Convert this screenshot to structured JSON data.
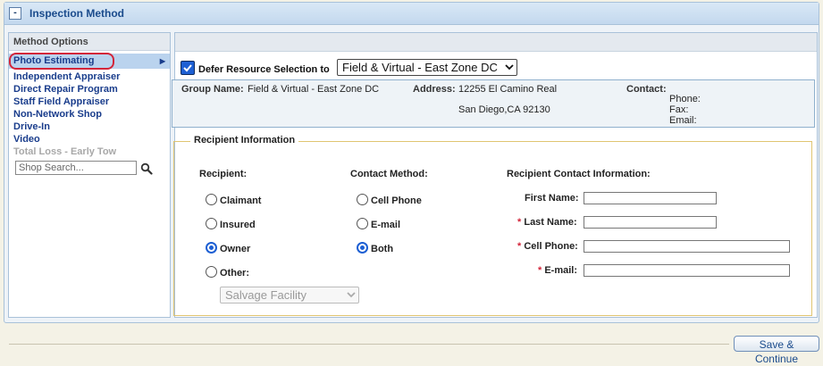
{
  "panel": {
    "title": "Inspection Method",
    "collapse_label": "-"
  },
  "method_options": {
    "heading": "Method Options",
    "selected": "Photo Estimating",
    "items": [
      "Independent Appraiser",
      "Direct Repair Program",
      "Staff Field Appraiser",
      "Non-Network Shop",
      "Drive-In",
      "Video"
    ],
    "disabled_item": "Total Loss - Early Tow",
    "shop_search_placeholder": "Shop Search..."
  },
  "defer": {
    "label": "Defer Resource Selection to",
    "checked": true,
    "selected_resource": "Field & Virtual - East Zone DC"
  },
  "group": {
    "group_name_label": "Group Name:",
    "group_name": "Field & Virtual - East Zone DC",
    "address_label": "Address:",
    "address_line1": "12255 El Camino Real",
    "address_line2": "San Diego,CA 92130",
    "contact_label": "Contact:",
    "phone_label": "Phone:",
    "fax_label": "Fax:",
    "email_label": "Email:"
  },
  "recipient": {
    "legend": "Recipient Information",
    "recipient_heading": "Recipient:",
    "recipient_options": [
      "Claimant",
      "Insured",
      "Owner",
      "Other:"
    ],
    "recipient_selected": "Owner",
    "other_select_value": "Salvage Facility",
    "contact_heading": "Contact Method:",
    "contact_options": [
      "Cell Phone",
      "E-mail",
      "Both"
    ],
    "contact_selected": "Both",
    "info_heading": "Recipient Contact Information:",
    "required_mark": "*",
    "fields": {
      "first_name": "First Name:",
      "last_name": "Last Name:",
      "cell_phone": "Cell Phone:",
      "email": "E-mail:"
    }
  },
  "footer": {
    "save_label": "Save & Continue"
  },
  "colors": {
    "accent": "#1a4b8c",
    "required": "#d3253a",
    "highlight_ring": "#d3253a",
    "fieldset_border": "#e0c572"
  }
}
